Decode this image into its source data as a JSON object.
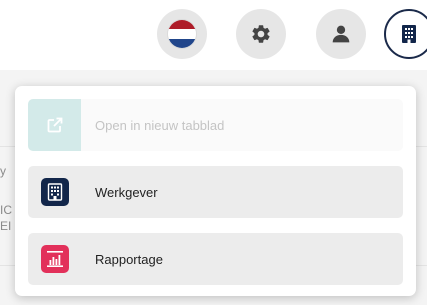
{
  "header": {
    "buttons": [
      {
        "name": "language-flag-button",
        "icon": "netherlands-flag-icon"
      },
      {
        "name": "settings-button",
        "icon": "gear-icon"
      },
      {
        "name": "user-button",
        "icon": "user-icon"
      },
      {
        "name": "company-button",
        "icon": "building-icon"
      }
    ]
  },
  "flag_colors": {
    "red": "#ae1c28",
    "white": "#ffffff",
    "blue": "#21468b"
  },
  "dropdown": {
    "items": [
      {
        "label": "Open in nieuw tabblad",
        "icon": "external-link-icon",
        "disabled": true,
        "accent": "#d3eae9"
      },
      {
        "label": "Werkgever",
        "icon": "building-icon",
        "disabled": false,
        "accent": "#12264a"
      },
      {
        "label": "Rapportage",
        "icon": "report-chart-icon",
        "disabled": false,
        "accent": "#e2305a"
      }
    ]
  },
  "background": {
    "partial_text": [
      "y",
      "IC",
      "EI"
    ]
  }
}
